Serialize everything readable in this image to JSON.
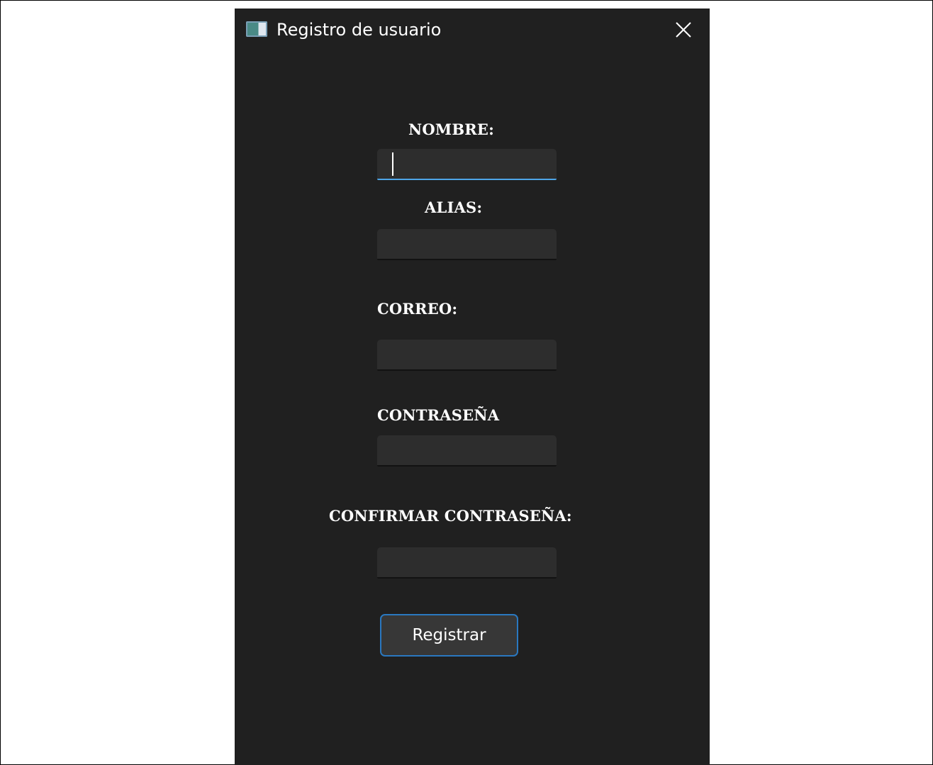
{
  "window": {
    "title": "Registro de usuario",
    "app_icon": "window-app-icon",
    "close_icon": "close-x-icon"
  },
  "form": {
    "nombre": {
      "label": "NOMBRE:",
      "value": ""
    },
    "alias": {
      "label": "ALIAS:",
      "value": ""
    },
    "correo": {
      "label": "CORREO:",
      "value": ""
    },
    "contrasena": {
      "label": "CONTRASEÑA",
      "value": ""
    },
    "confirmar": {
      "label": "CONFIRMAR CONTRASEÑA:",
      "value": ""
    },
    "submit_label": "Registrar"
  },
  "colors": {
    "window_background": "#202020",
    "input_background": "#2d2d2d",
    "focus_accent": "#4ea6e9",
    "button_border": "#2a78c0"
  }
}
